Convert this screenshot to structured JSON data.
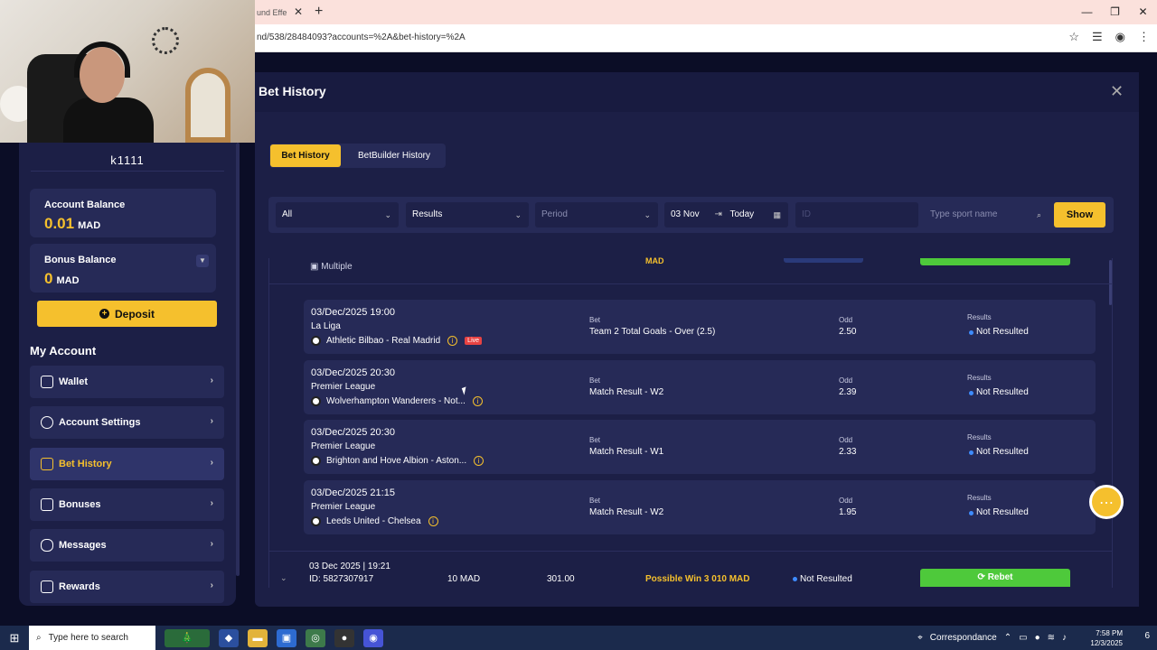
{
  "browser": {
    "tab_title": "und Effe",
    "url": "nd/538/28484093?accounts=%2A&bet-history=%2A"
  },
  "sidebar": {
    "username": "k1111",
    "account_balance": {
      "label": "Account Balance",
      "amount": "0.01",
      "currency": "MAD"
    },
    "bonus_balance": {
      "label": "Bonus Balance",
      "amount": "0",
      "currency": "MAD"
    },
    "deposit_label": "Deposit",
    "my_account_title": "My Account",
    "menu": [
      {
        "label": "Wallet",
        "icon": "wallet-icon"
      },
      {
        "label": "Account Settings",
        "icon": "user-icon"
      },
      {
        "label": "Bet History",
        "icon": "history-icon",
        "active": true
      },
      {
        "label": "Bonuses",
        "icon": "gift-icon"
      },
      {
        "label": "Messages",
        "icon": "message-icon"
      },
      {
        "label": "Rewards",
        "icon": "reward-icon"
      }
    ]
  },
  "modal": {
    "title": "Bet History",
    "tabs": [
      "Bet History",
      "BetBuilder History"
    ],
    "filters": {
      "all": "All",
      "results": "Results",
      "period": "Period",
      "date_from": "03 Nov",
      "date_to": "Today",
      "id_placeholder": "ID",
      "sport_placeholder": "Type sport name",
      "show_label": "Show"
    }
  },
  "top_row": {
    "type_label": "Multiple",
    "amount_fragment": "MAD"
  },
  "bets": [
    {
      "date": "03/Dec/2025 19:00",
      "league": "La Liga",
      "match": "Athletic Bilbao - Real Madrid",
      "live": "Live",
      "bet_label": "Bet",
      "bet": "Team 2 Total Goals - Over (2.5)",
      "odd_label": "Odd",
      "odd": "2.50",
      "results_label": "Results",
      "result": "Not Resulted"
    },
    {
      "date": "03/Dec/2025 20:30",
      "league": "Premier League",
      "match": "Wolverhampton Wanderers - Not...",
      "bet_label": "Bet",
      "bet": "Match Result - W2",
      "odd_label": "Odd",
      "odd": "2.39",
      "results_label": "Results",
      "result": "Not Resulted"
    },
    {
      "date": "03/Dec/2025 20:30",
      "league": "Premier League",
      "match": "Brighton and Hove Albion - Aston...",
      "bet_label": "Bet",
      "bet": "Match Result - W1",
      "odd_label": "Odd",
      "odd": "2.33",
      "results_label": "Results",
      "result": "Not Resulted"
    },
    {
      "date": "03/Dec/2025 21:15",
      "league": "Premier League",
      "match": "Leeds United - Chelsea",
      "bet_label": "Bet",
      "bet": "Match Result - W2",
      "odd_label": "Odd",
      "odd": "1.95",
      "results_label": "Results",
      "result": "Not Resulted"
    }
  ],
  "bottom_row": {
    "date": "03 Dec 2025 | 19:21",
    "id": "ID: 5827307917",
    "stake": "10 MAD",
    "odd": "301.00",
    "possible_win": "Possible Win 3 010 MAD",
    "result": "Not Resulted",
    "rebet_label": "Rebet"
  },
  "taskbar": {
    "search_placeholder": "Type here to search",
    "location": "Correspondance",
    "time": "7:58 PM",
    "date": "12/3/2025",
    "notification_count": "6"
  },
  "colors": {
    "accent": "#f5c02d",
    "bg": "#1c1f46",
    "green": "#4ec93b",
    "status_blue": "#3e8cff"
  }
}
